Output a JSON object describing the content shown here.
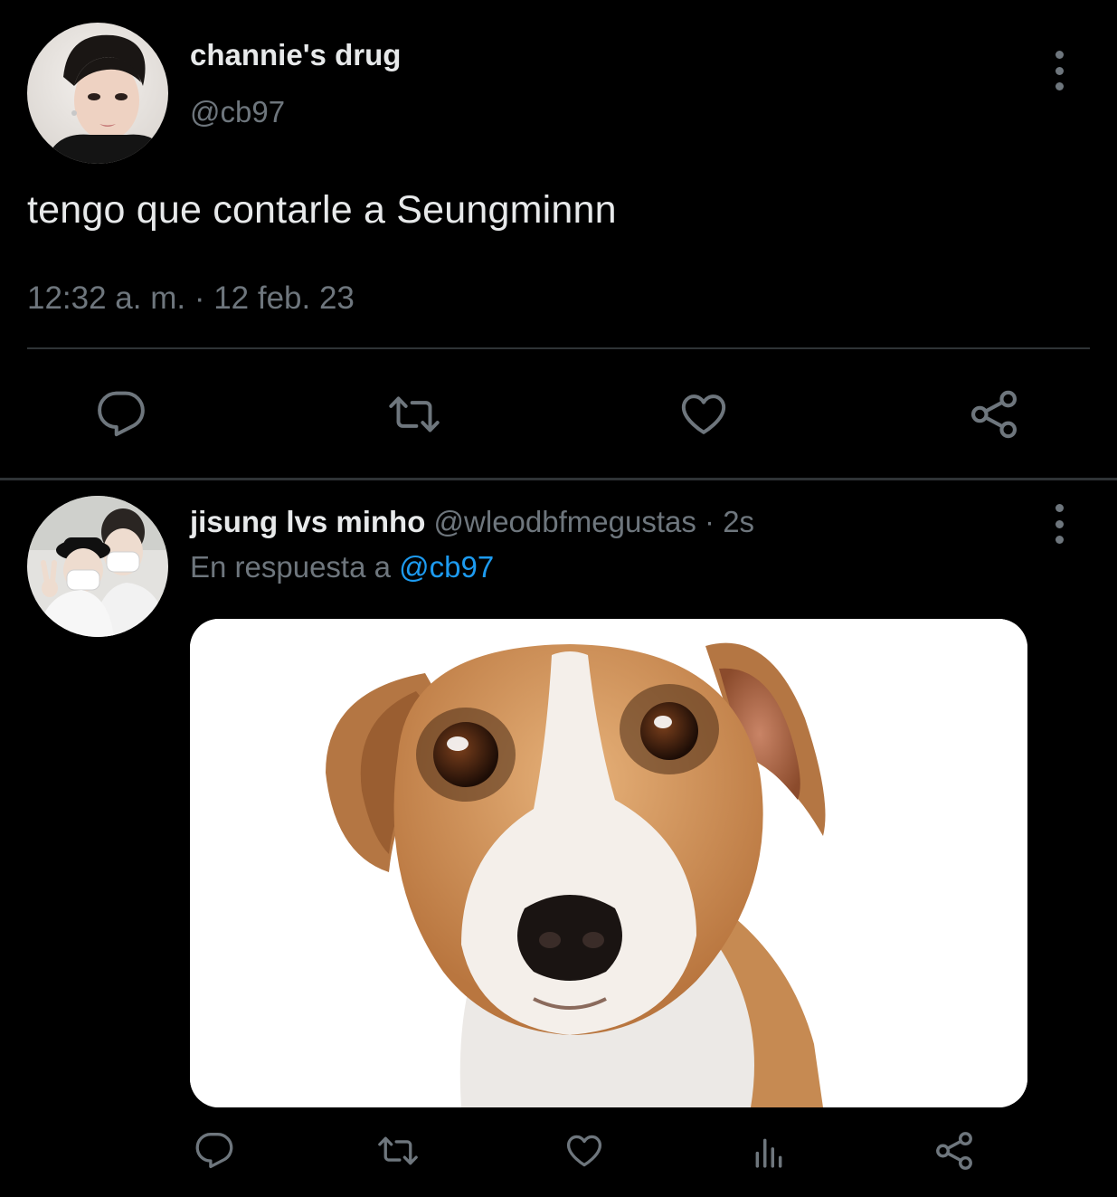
{
  "main_tweet": {
    "display_name": "channie's drug",
    "handle": "@cb97",
    "text": "tengo que contarle a Seungminnn",
    "timestamp": "12:32 a. m. · 12 feb. 23",
    "actions": [
      "reply-icon",
      "retweet-icon",
      "like-icon",
      "share-icon"
    ]
  },
  "reply_tweet": {
    "display_name": "jisung lvs minho",
    "handle": "@wleodbfmegustas",
    "separator": "·",
    "time": "2s",
    "reply_prefix": "En respuesta a",
    "reply_to": "@cb97",
    "media": "dog-photo",
    "actions": [
      "reply-icon",
      "retweet-icon",
      "like-icon",
      "views-icon",
      "share-icon"
    ]
  },
  "colors": {
    "background": "#000000",
    "primary_text": "#e7e9ea",
    "secondary_text": "#6e767d",
    "link": "#1d9bf0",
    "divider": "#2f3336"
  }
}
